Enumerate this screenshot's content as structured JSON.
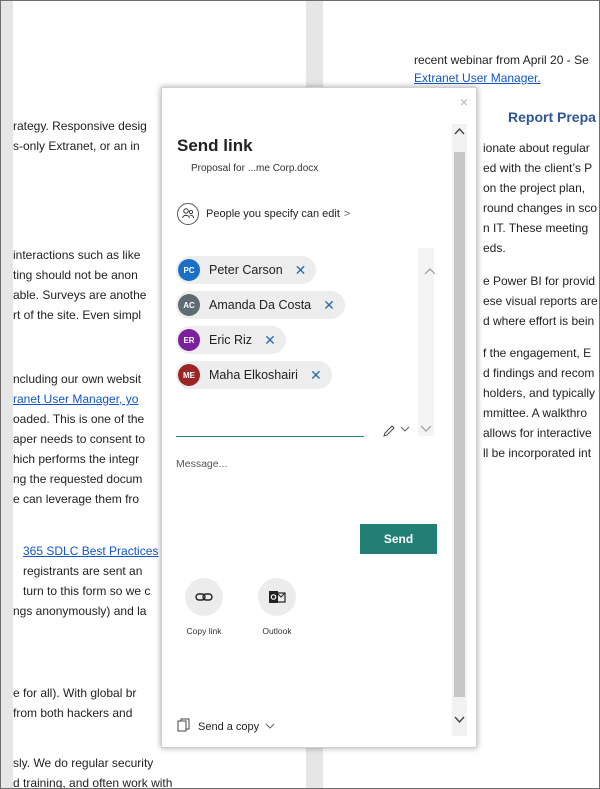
{
  "document": {
    "left_lines": [
      "rategy. Responsive desig",
      "s-only Extranet, or an in",
      "interactions such as like",
      "ting should not be anon",
      "able. Surveys are anothe",
      "rt of the site. Even simpl",
      "ncluding our own websit",
      "ranet User Manager, yo",
      "oaded. This is one of the",
      "aper needs to consent to",
      "hich performs the integr",
      "ng the requested docum",
      "e can leverage them fro",
      "365 SDLC Best Practices",
      "registrants are sent an",
      "turn to this form so we c",
      "ngs anonymously) and la",
      "e for all). With global br",
      "from both hackers and",
      "sly. We do regular security",
      "d training, and often work with"
    ],
    "right_lines": [
      "recent webinar from April 20 - Se",
      "Extranet User Manager.",
      "Report Prepa",
      "ionate about regular",
      "ed with the client’s P",
      "on the project plan,",
      "round changes in sco",
      "n IT.  These meeting",
      "eds.",
      "e Power BI for provid",
      "ese visual reports are",
      "d where effort is bein",
      "f the engagement, E",
      "d findings and recom",
      "holders, and typically",
      "mmittee. A walkthro",
      "allows for interactive",
      "ll be incorporated int"
    ]
  },
  "dialog": {
    "close_glyph": "×",
    "title": "Send link",
    "filename": "Proposal for ...me Corp.docx",
    "permission": "People you specify can edit",
    "permission_chevron": ">",
    "recipients": [
      {
        "initials": "PC",
        "name": "Peter Carson",
        "color": "#1a6fc9"
      },
      {
        "initials": "AC",
        "name": "Amanda Da Costa",
        "color": "#5d6b73"
      },
      {
        "initials": "ER",
        "name": "Eric Riz",
        "color": "#7a1f9e"
      },
      {
        "initials": "ME",
        "name": "Maha Elkoshairi",
        "color": "#9c2424"
      }
    ],
    "remove_glyph": "✕",
    "message_placeholder": "Message...",
    "send_label": "Send",
    "actions": [
      {
        "label": "Copy link",
        "icon": "link-icon"
      },
      {
        "label": "Outlook",
        "icon": "outlook-icon"
      }
    ],
    "footer_label": "Send a copy",
    "accent_color": "#217f75"
  }
}
